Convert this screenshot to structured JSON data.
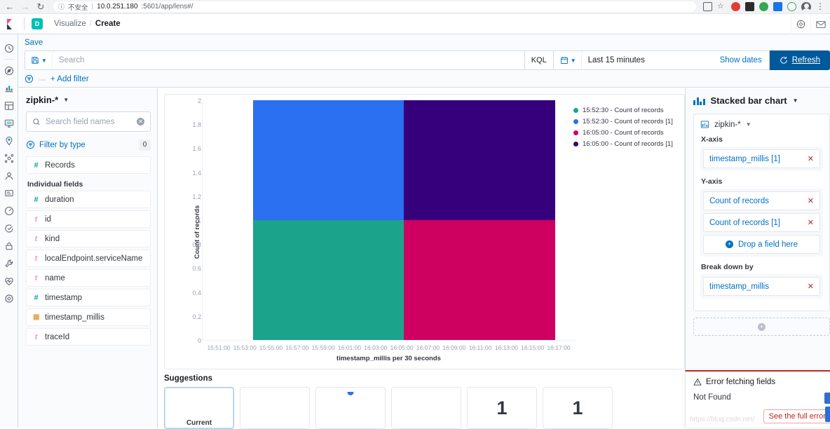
{
  "browser": {
    "back_icon": "arrow-left-icon",
    "forward_icon": "arrow-right-icon",
    "reload_icon": "reload-icon",
    "info_icon": "info-circle-icon",
    "security_text": "不安全",
    "url_host": "10.0.251.180",
    "url_path": ":5601/app/lens#/",
    "extensions": [
      "translate-icon",
      "bookmark-star-icon",
      "adblock-icon",
      "extension-dark-icon",
      "globe-extension-icon",
      "blue-extension-icon",
      "green-extension-icon"
    ],
    "profile_icon": "profile-avatar-icon",
    "menu_icon": "chrome-menu-icon"
  },
  "header": {
    "logo": "kibana-logo-icon",
    "space_badge": "D",
    "breadcrumb": {
      "parent": "Visualize",
      "separator": "/",
      "current": "Create"
    },
    "right_icons": [
      "help-circle-icon",
      "mail-icon"
    ]
  },
  "nav_rail": {
    "items": [
      {
        "name": "recently-viewed",
        "icon": "clock-icon"
      },
      {
        "name": "discover",
        "icon": "compass-icon"
      },
      {
        "name": "visualize",
        "icon": "bar-chart-icon"
      },
      {
        "name": "dashboard",
        "icon": "dashboard-icon"
      },
      {
        "name": "canvas",
        "icon": "presentation-icon"
      },
      {
        "name": "maps",
        "icon": "map-marker-icon"
      },
      {
        "name": "machine-learning",
        "icon": "ml-nodes-icon"
      },
      {
        "name": "infrastructure",
        "icon": "user-monitor-icon"
      },
      {
        "name": "logs",
        "icon": "logs-icon"
      },
      {
        "name": "apm",
        "icon": "apm-icon"
      },
      {
        "name": "uptime",
        "icon": "uptime-check-icon"
      },
      {
        "name": "security",
        "icon": "lock-icon"
      },
      {
        "name": "dev-tools",
        "icon": "wrench-icon"
      },
      {
        "name": "monitoring",
        "icon": "heartbeat-icon"
      },
      {
        "name": "management",
        "icon": "gear-icon"
      }
    ]
  },
  "query_bar": {
    "save_label": "Save",
    "saved_query_icon": "save-disk-icon",
    "chevron_icon": "chevron-down-icon",
    "search_placeholder": "Search",
    "search_value": "",
    "language_label": "KQL",
    "calendar_icon": "calendar-icon",
    "time_range": "Last 15 minutes",
    "show_dates_label": "Show dates",
    "refresh_label": "Refresh",
    "refresh_icon": "refresh-icon",
    "filter_icon": "filter-list-icon",
    "add_filter_label": "+ Add filter"
  },
  "data_panel": {
    "datasource": "zipkin-*",
    "datasource_chevron": "chevron-down-icon",
    "search_icon": "search-icon",
    "search_placeholder": "Search field names",
    "clear_icon": "clear-circle-icon",
    "filter_by_type_label": "Filter by type",
    "filter_by_type_icon": "filter-list-icon",
    "filter_count": "0",
    "records_field": {
      "label": "Records",
      "type": "number"
    },
    "individual_fields_label": "Individual fields",
    "fields": [
      {
        "label": "duration",
        "type": "number"
      },
      {
        "label": "id",
        "type": "string"
      },
      {
        "label": "kind",
        "type": "string"
      },
      {
        "label": "localEndpoint.serviceName",
        "type": "string"
      },
      {
        "label": "name",
        "type": "string"
      },
      {
        "label": "timestamp",
        "type": "number"
      },
      {
        "label": "timestamp_millis",
        "type": "date"
      },
      {
        "label": "traceId",
        "type": "string"
      }
    ]
  },
  "chart_data": {
    "type": "bar",
    "stacked": true,
    "title": "",
    "xlabel": "timestamp_millis per 30 seconds",
    "ylabel": "Count of records",
    "ylim": [
      0,
      2
    ],
    "y_ticks": [
      "0",
      "0.2",
      "0.4",
      "0.6",
      "0.8",
      "1",
      "1.2",
      "1.4",
      "1.6",
      "1.8",
      "2"
    ],
    "x_ticks": [
      "15:51:00",
      "15:53:00",
      "15:55:00",
      "15:57:00",
      "15:59:00",
      "16:01:00",
      "16:03:00",
      "16:05:00",
      "16:07:00",
      "16:09:00",
      "16:11:00",
      "16:13:00",
      "16:15:00",
      "16:17:00"
    ],
    "grid": false,
    "legend_position": "right",
    "categories": [
      "15:52:30",
      "16:05:00"
    ],
    "series": [
      {
        "name": "15:52:30 - Count of records",
        "color": "#1ba38c",
        "values": [
          1,
          0
        ]
      },
      {
        "name": "15:52:30 - Count of records [1]",
        "color": "#2a70f0",
        "values": [
          1,
          0
        ]
      },
      {
        "name": "16:05:00 - Count of records",
        "color": "#ce0060",
        "values": [
          0,
          1
        ]
      },
      {
        "name": "16:05:00 - Count of records [1]",
        "color": "#36007d",
        "values": [
          0,
          1
        ]
      }
    ],
    "bars": [
      {
        "x": "15:52:30",
        "left_pct": 13.5,
        "segments": [
          {
            "series": "15:52:30 - Count of records",
            "color": "#1ba38c",
            "value": 1
          },
          {
            "series": "15:52:30 - Count of records [1]",
            "color": "#2a70f0",
            "value": 1
          }
        ]
      },
      {
        "x": "16:05:00",
        "left_pct": 54.0,
        "segments": [
          {
            "series": "16:05:00 - Count of records",
            "color": "#ce0060",
            "value": 1
          },
          {
            "series": "16:05:00 - Count of records [1]",
            "color": "#36007d",
            "value": 1
          }
        ]
      }
    ]
  },
  "suggestions": {
    "title": "Suggestions",
    "cards": [
      {
        "name": "current",
        "label": "Current",
        "selected": true,
        "kind": "label"
      },
      {
        "name": "suggestion-2",
        "label": "",
        "selected": false,
        "kind": "blank"
      },
      {
        "name": "suggestion-3",
        "label": "",
        "selected": false,
        "kind": "mini-bar"
      },
      {
        "name": "suggestion-4",
        "label": "",
        "selected": false,
        "kind": "blank"
      },
      {
        "name": "suggestion-5",
        "label": "1",
        "selected": false,
        "kind": "metric"
      },
      {
        "name": "suggestion-6",
        "label": "1",
        "selected": false,
        "kind": "metric"
      }
    ]
  },
  "config_panel": {
    "chart_type": "Stacked bar chart",
    "chart_type_icon": "stacked-bar-icon",
    "chart_type_chevron": "chevron-down-icon",
    "layer_source": "zipkin-*",
    "layer_source_icon": "index-pattern-icon",
    "layer_source_chevron": "chevron-down-icon",
    "groups": [
      {
        "label": "X-axis",
        "chips": [
          {
            "text": "timestamp_millis [1]",
            "remove_icon": "close-x-icon"
          }
        ],
        "drop_label": null
      },
      {
        "label": "Y-axis",
        "chips": [
          {
            "text": "Count of records",
            "remove_icon": "close-x-icon"
          },
          {
            "text": "Count of records [1]",
            "remove_icon": "close-x-icon"
          }
        ],
        "drop_label": "Drop a field here"
      },
      {
        "label": "Break down by",
        "chips": [
          {
            "text": "timestamp_millis",
            "remove_icon": "close-x-icon"
          }
        ],
        "drop_label": null
      }
    ],
    "add_layer_icon": "plus-circle-icon"
  },
  "toast": {
    "warning_icon": "warning-triangle-icon",
    "title": "Error fetching fields",
    "body": "Not Found",
    "action_label": "See the full error",
    "watermark": "https://blog.csdn.net/",
    "accent_color": "#bd271e"
  }
}
